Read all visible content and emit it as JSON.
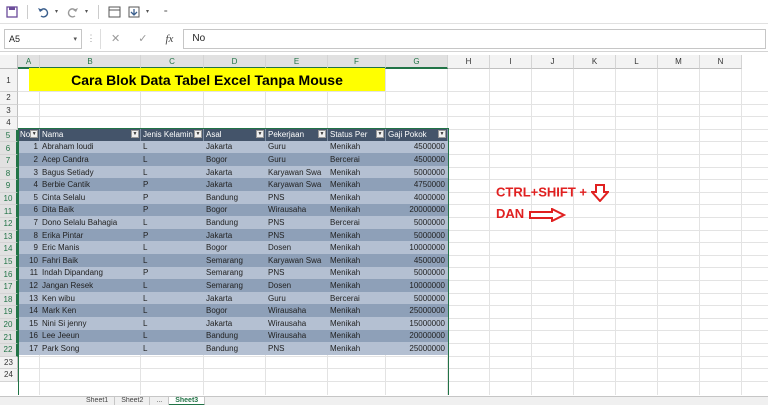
{
  "toolbar": {
    "icons": [
      "save-icon",
      "undo-icon",
      "redo-icon",
      "form-icon",
      "sort-icon",
      "customize-icon"
    ]
  },
  "formula_bar": {
    "name_box": "A5",
    "fx_label": "fx",
    "value": "No"
  },
  "columns": [
    "A",
    "B",
    "C",
    "D",
    "E",
    "F",
    "G",
    "H",
    "I",
    "J",
    "K",
    "L",
    "M",
    "N"
  ],
  "rows": [
    "1",
    "2",
    "3",
    "4",
    "5",
    "6",
    "7",
    "8",
    "9",
    "10",
    "11",
    "12",
    "13",
    "14",
    "15",
    "16",
    "17",
    "18",
    "19",
    "20",
    "21",
    "22",
    "23",
    "24"
  ],
  "title": "Cara Blok Data Tabel Excel Tanpa Mouse",
  "table": {
    "headers": [
      "No",
      "Nama",
      "Jenis Kelamin",
      "Asal",
      "Pekerjaan",
      "Status Per",
      "Gaji Pokok"
    ],
    "rows": [
      [
        "1",
        "Abraham loudi",
        "L",
        "Jakarta",
        "Guru",
        "Menikah",
        "4500000"
      ],
      [
        "2",
        "Acep Candra",
        "L",
        "Bogor",
        "Guru",
        "Bercerai",
        "4500000"
      ],
      [
        "3",
        "Bagus Setiady",
        "L",
        "Jakarta",
        "Karyawan Swa",
        "Menikah",
        "5000000"
      ],
      [
        "4",
        "Berbie Cantik",
        "P",
        "Jakarta",
        "Karyawan Swa",
        "Menikah",
        "4750000"
      ],
      [
        "5",
        "Cinta Selalu",
        "P",
        "Bandung",
        "PNS",
        "Menikah",
        "4000000"
      ],
      [
        "6",
        "Dita Baik",
        "P",
        "Bogor",
        "Wirausaha",
        "Menikah",
        "20000000"
      ],
      [
        "7",
        "Dono Selalu Bahagia",
        "L",
        "Bandung",
        "PNS",
        "Bercerai",
        "5000000"
      ],
      [
        "8",
        "Erika Pintar",
        "P",
        "Jakarta",
        "PNS",
        "Menikah",
        "5000000"
      ],
      [
        "9",
        "Eric Manis",
        "L",
        "Bogor",
        "Dosen",
        "Menikah",
        "10000000"
      ],
      [
        "10",
        "Fahri Baik",
        "L",
        "Semarang",
        "Karyawan Swa",
        "Menikah",
        "4500000"
      ],
      [
        "11",
        "Indah Dipandang",
        "P",
        "Semarang",
        "PNS",
        "Menikah",
        "5000000"
      ],
      [
        "12",
        "Jangan Resek",
        "L",
        "Semarang",
        "Dosen",
        "Menikah",
        "10000000"
      ],
      [
        "13",
        "Ken wibu",
        "L",
        "Jakarta",
        "Guru",
        "Bercerai",
        "5000000"
      ],
      [
        "14",
        "Mark Ken",
        "L",
        "Bogor",
        "Wirausaha",
        "Menikah",
        "25000000"
      ],
      [
        "15",
        "Nini Si jenny",
        "L",
        "Jakarta",
        "Wirausaha",
        "Menikah",
        "15000000"
      ],
      [
        "16",
        "Lee Jeeun",
        "L",
        "Bandung",
        "Wirausaha",
        "Menikah",
        "20000000"
      ],
      [
        "17",
        "Park Song",
        "L",
        "Bandung",
        "PNS",
        "Menikah",
        "25000000"
      ]
    ]
  },
  "annotation": {
    "line1": "CTRL+SHIFT +",
    "line2": "DAN"
  },
  "sheet_tabs": [
    "Sheet1",
    "Sheet2",
    "...",
    "Sheet3"
  ],
  "colors": {
    "accent": "#217346",
    "header": "#44546a",
    "band_light": "#b4c0d2",
    "band_dark": "#8ea0b8",
    "title_bg": "#ffff00",
    "annotation": "#e02020"
  }
}
